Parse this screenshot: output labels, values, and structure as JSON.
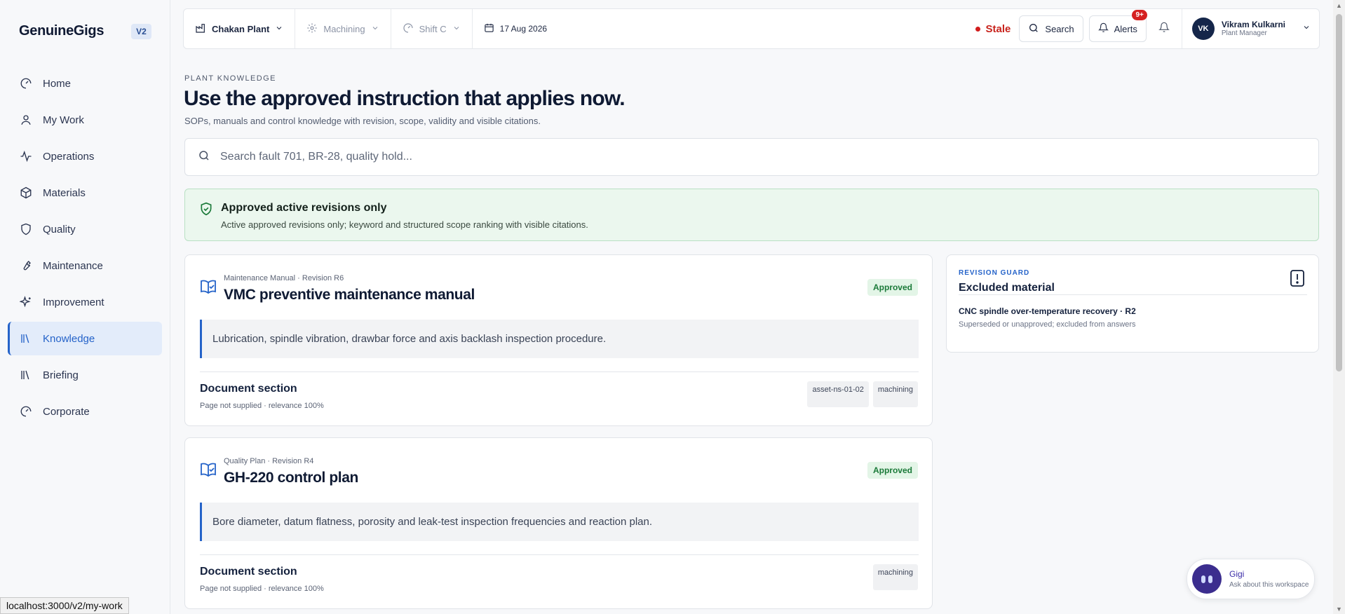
{
  "brand": {
    "name": "GenuineGigs",
    "version": "V2"
  },
  "nav": [
    {
      "label": "Home",
      "icon": "gauge-icon"
    },
    {
      "label": "My Work",
      "icon": "user-icon"
    },
    {
      "label": "Operations",
      "icon": "activity-icon"
    },
    {
      "label": "Materials",
      "icon": "box-icon"
    },
    {
      "label": "Quality",
      "icon": "shield-icon"
    },
    {
      "label": "Maintenance",
      "icon": "wrench-icon"
    },
    {
      "label": "Improvement",
      "icon": "sparkles-icon"
    },
    {
      "label": "Knowledge",
      "icon": "library-icon",
      "active": true
    },
    {
      "label": "Briefing",
      "icon": "library-icon"
    },
    {
      "label": "Corporate",
      "icon": "gauge-icon"
    }
  ],
  "status_url": "localhost:3000/v2/my-work",
  "topbar": {
    "plant": "Chakan Plant",
    "area": "Machining",
    "shift": "Shift C",
    "date": "17 Aug 2026",
    "stale_label": "Stale",
    "search_label": "Search",
    "alerts_label": "Alerts",
    "alerts_badge": "9+",
    "user_name": "Vikram Kulkarni",
    "user_role": "Plant Manager",
    "user_initials": "VK"
  },
  "header": {
    "eyebrow": "PLANT KNOWLEDGE",
    "title": "Use the approved instruction that applies now.",
    "subtitle": "SOPs, manuals and control knowledge with revision, scope, validity and visible citations."
  },
  "search": {
    "placeholder": "Search fault 701, BR-28, quality hold..."
  },
  "banner": {
    "title": "Approved active revisions only",
    "desc": "Active approved revisions only; keyword and structured scope ranking with visible citations."
  },
  "cards": [
    {
      "meta": "Maintenance Manual · Revision R6",
      "title": "VMC preventive maintenance manual",
      "status": "Approved",
      "excerpt": "Lubrication, spindle vibration, drawbar force and axis backlash inspection procedure.",
      "section": "Document section",
      "relevance": "Page not supplied · relevance 100%",
      "tags": [
        "asset-ns-01-02",
        "machining"
      ]
    },
    {
      "meta": "Quality Plan · Revision R4",
      "title": "GH-220 control plan",
      "status": "Approved",
      "excerpt": "Bore diameter, datum flatness, porosity and leak-test inspection frequencies and reaction plan.",
      "section": "Document section",
      "relevance": "Page not supplied · relevance 100%",
      "tags": [
        "machining"
      ]
    }
  ],
  "guard": {
    "label": "REVISION GUARD",
    "title": "Excluded material",
    "item": "CNC spindle over-temperature recovery · R2",
    "item_desc": "Superseded or unapproved; excluded from answers"
  },
  "assistant": {
    "name": "Gigi",
    "subtitle": "Ask about this workspace"
  }
}
